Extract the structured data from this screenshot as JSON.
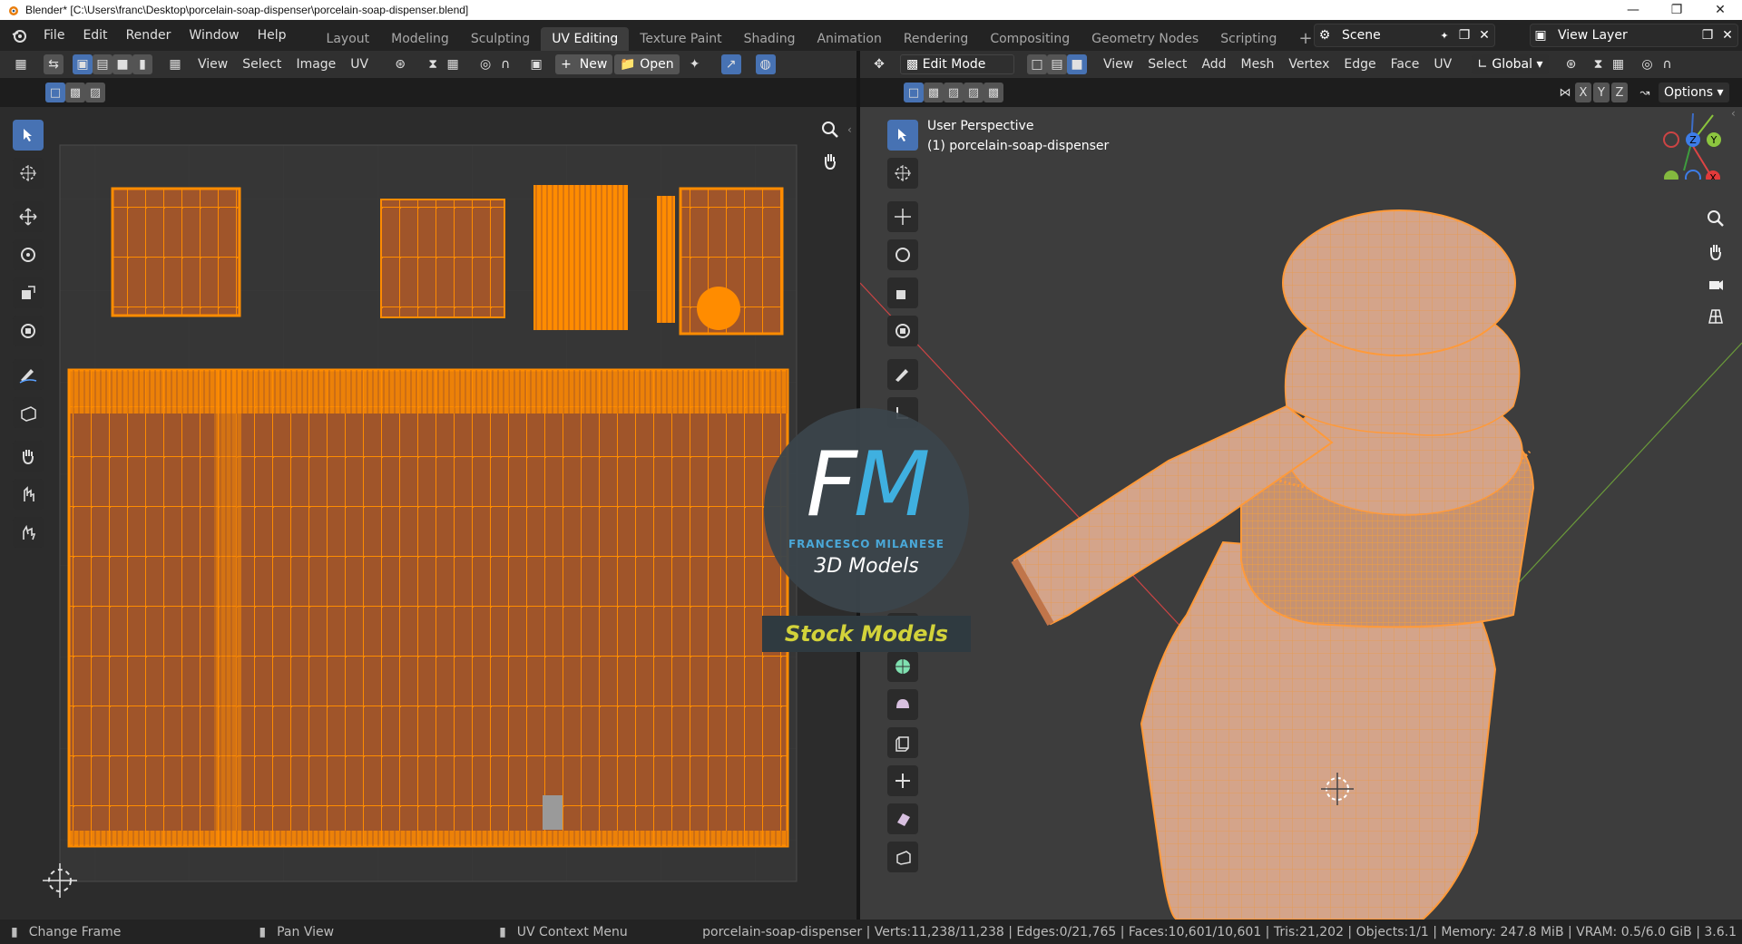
{
  "titlebar": {
    "title": "Blender* [C:\\Users\\franc\\Desktop\\porcelain-soap-dispenser\\porcelain-soap-dispenser.blend]"
  },
  "menu": [
    "File",
    "Edit",
    "Render",
    "Window",
    "Help"
  ],
  "workspaces": [
    "Layout",
    "Modeling",
    "Sculpting",
    "UV Editing",
    "Texture Paint",
    "Shading",
    "Animation",
    "Rendering",
    "Compositing",
    "Geometry Nodes",
    "Scripting"
  ],
  "active_workspace": "UV Editing",
  "add_tab": "+",
  "scene": {
    "value": "Scene"
  },
  "view_layer": {
    "value": "View Layer"
  },
  "uv_editor": {
    "header": {
      "view": "View",
      "select": "Select",
      "image": "Image",
      "uv": "UV",
      "new": "New",
      "open": "Open"
    }
  },
  "viewport": {
    "header": {
      "mode": "Edit Mode",
      "view": "View",
      "select": "Select",
      "add": "Add",
      "mesh": "Mesh",
      "vertex": "Vertex",
      "edge": "Edge",
      "face": "Face",
      "uv": "UV",
      "orientation": "Global",
      "options": "Options"
    },
    "axes": {
      "x": "X",
      "y": "Y",
      "z": "Z"
    },
    "overlay_line1": "User Perspective",
    "overlay_line2": "(1) porcelain-soap-dispenser",
    "gizmo": {
      "x": "X",
      "y": "Y",
      "z": "Z"
    }
  },
  "watermark": {
    "letters": "FM",
    "name": "FRANCESCO MILANESE",
    "sub": "3D Models",
    "banner": "Stock Models"
  },
  "status": {
    "hint1": "Change Frame",
    "hint2": "Pan View",
    "hint3": "UV Context Menu",
    "stats": "porcelain-soap-dispenser | Verts:11,238/11,238 | Edges:0/21,765 | Faces:10,601/10,601 | Tris:21,202 | Objects:1/1 | Memory: 247.8 MiB | VRAM: 0.5/6.0 GiB | 3.6.1"
  },
  "colors": {
    "accent": "#4772b3",
    "uv_orange": "#ff8c00",
    "uv_fill": "#a85a2a",
    "panel": "#303030"
  }
}
